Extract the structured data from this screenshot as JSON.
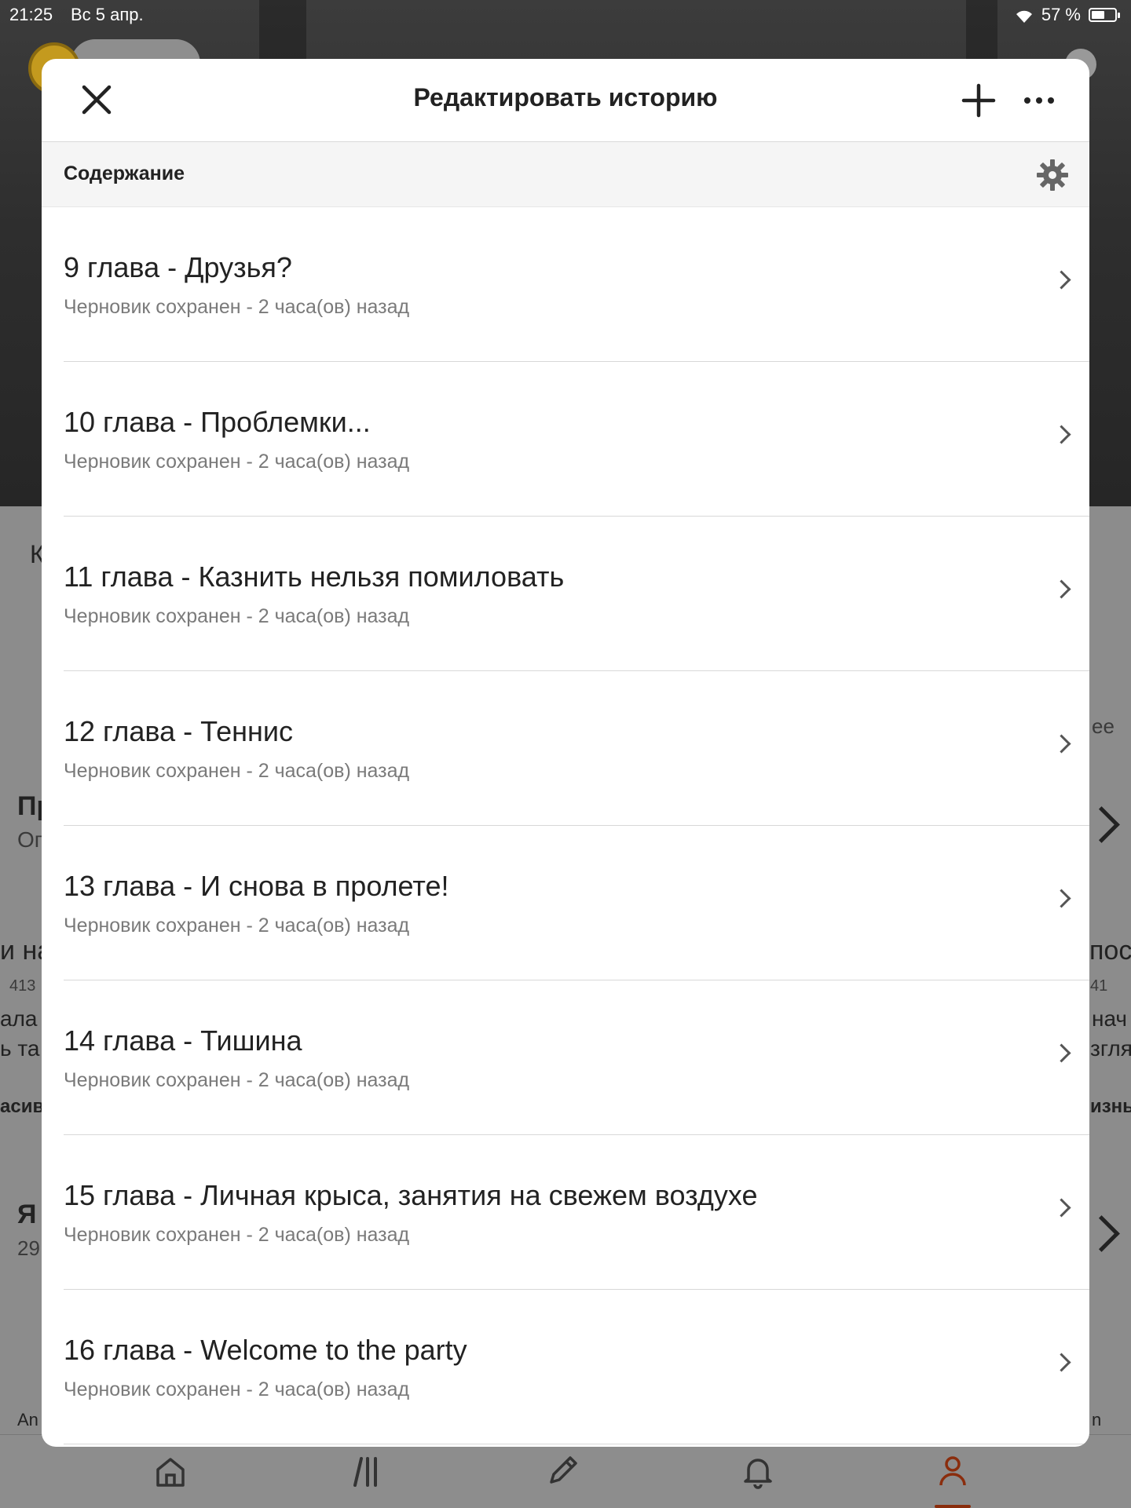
{
  "status_bar": {
    "time": "21:25",
    "date": "Вс 5 апр.",
    "battery_text": "57 %",
    "battery_level": 0.57
  },
  "background": {
    "fragments": [
      "К",
      "ее",
      "Пр",
      "Ог",
      "и на",
      "посл",
      "413",
      "41",
      "ала б",
      "нач",
      "ь та",
      "згля",
      "асив",
      "изнь",
      "Я",
      "29",
      "An",
      "n"
    ]
  },
  "modal": {
    "title": "Редактировать историю",
    "section_title": "Содержание",
    "parts": [
      {
        "title": "9 глава - Друзья?",
        "status": "Черновик сохранен - 2 часа(ов) назад"
      },
      {
        "title": "10 глава - Проблемки...",
        "status": "Черновик сохранен - 2 часа(ов) назад"
      },
      {
        "title": "11 глава -  Казнить нельзя помиловать",
        "status": "Черновик сохранен - 2 часа(ов) назад"
      },
      {
        "title": "12 глава - Теннис",
        "status": "Черновик сохранен - 2 часа(ов) назад"
      },
      {
        "title": "13 глава - И снова в пролете!",
        "status": "Черновик сохранен - 2 часа(ов) назад"
      },
      {
        "title": "14 глава - Тишина",
        "status": "Черновик сохранен - 2 часа(ов) назад"
      },
      {
        "title": "15 глава - Личная крыса, занятия на свежем воздухе",
        "status": "Черновик сохранен - 2 часа(ов) назад"
      },
      {
        "title": "16 глава - Welcome to the party",
        "status": "Черновик сохранен - 2 часа(ов) назад"
      }
    ],
    "icons": {
      "close": "close-icon",
      "add": "plus-icon",
      "more": "ellipsis-icon",
      "settings": "gear-icon",
      "row": "chevron-right-icon"
    }
  },
  "tabbar": {
    "tabs": [
      "home-icon",
      "library-icon",
      "pencil-icon",
      "bell-icon",
      "profile-icon"
    ],
    "active": "profile-icon"
  },
  "colors": {
    "accent": "#8a2d0d",
    "modal_bg": "#ffffff",
    "section_bg": "#f5f5f5",
    "status_text": "#7a7a7a"
  }
}
